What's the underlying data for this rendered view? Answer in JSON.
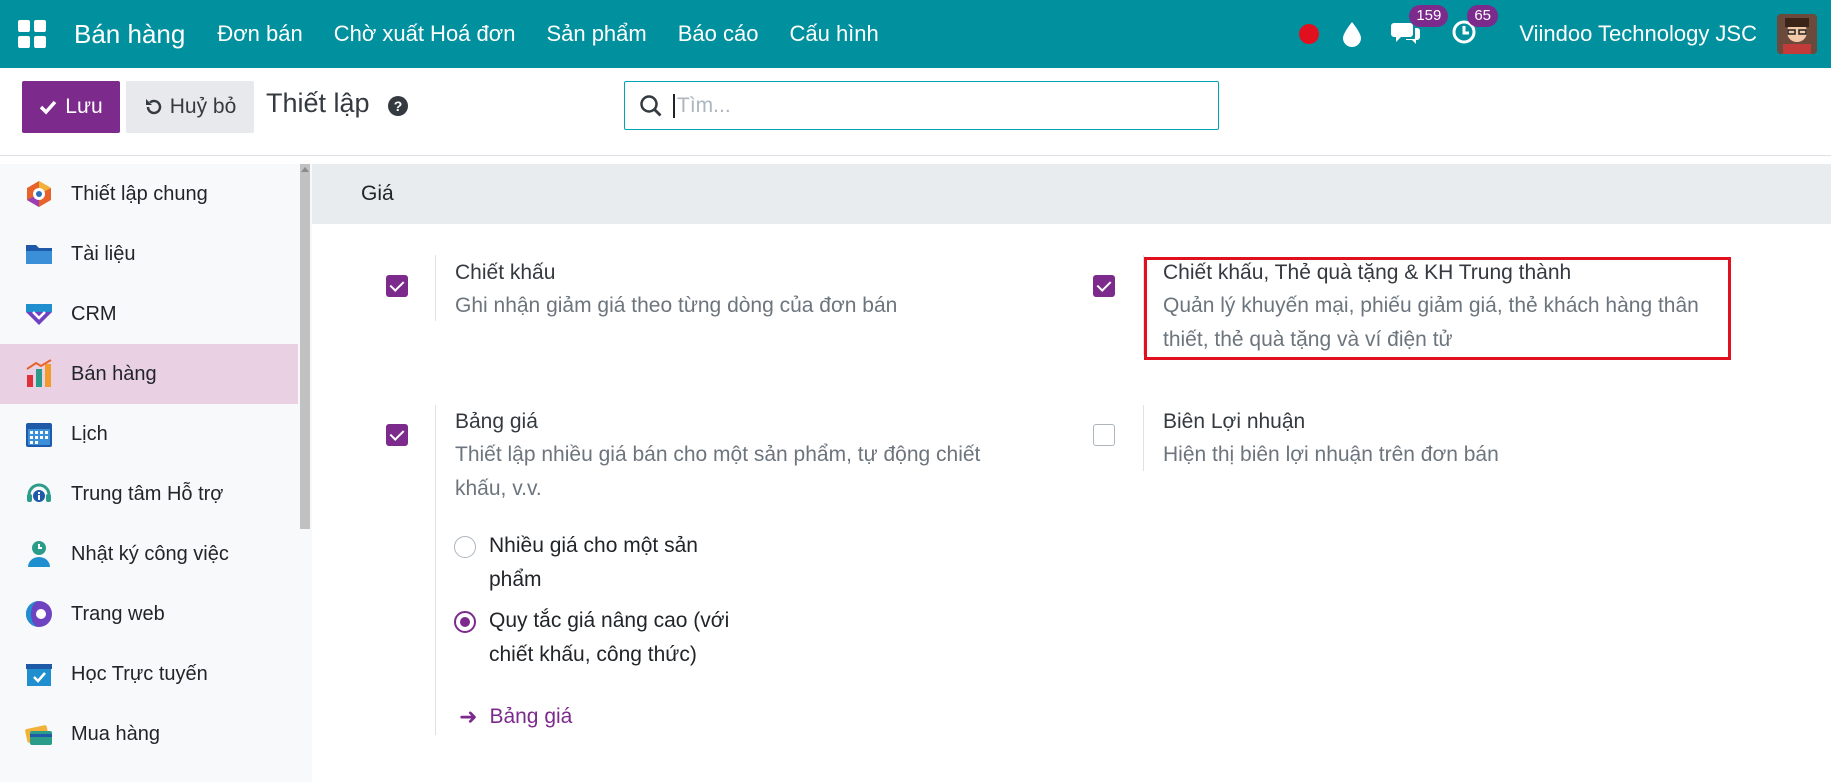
{
  "navbar": {
    "brand": "Bán hàng",
    "menu": [
      "Đơn bán",
      "Chờ xuất Hoá đơn",
      "Sản phẩm",
      "Báo cáo",
      "Cấu hình"
    ],
    "messages_badge": "159",
    "activities_badge": "65",
    "company": "Viindoo Technology JSC"
  },
  "control": {
    "save_label": "Lưu",
    "discard_label": "Huỷ bỏ",
    "title": "Thiết lập",
    "search_placeholder": "Tìm..."
  },
  "sidebar": {
    "items": [
      {
        "label": "Thiết lập chung",
        "icon": "settings-app-icon",
        "color": "#e8632a"
      },
      {
        "label": "Tài liệu",
        "icon": "folder-icon",
        "color": "#2c6fb8"
      },
      {
        "label": "CRM",
        "icon": "crm-icon",
        "color": "#2079d4"
      },
      {
        "label": "Bán hàng",
        "icon": "sales-chart-icon",
        "color": "#f29b2a",
        "active": true
      },
      {
        "label": "Lịch",
        "icon": "calendar-icon",
        "color": "#2c6fb8"
      },
      {
        "label": "Trung tâm Hỗ trợ",
        "icon": "helpdesk-icon",
        "color": "#17a2b8"
      },
      {
        "label": "Nhật ký công việc",
        "icon": "timesheet-icon",
        "color": "#17a2b8"
      },
      {
        "label": "Trang web",
        "icon": "website-icon",
        "color": "#6f42c1"
      },
      {
        "label": "Học Trực tuyến",
        "icon": "elearning-icon",
        "color": "#1f8fd0"
      },
      {
        "label": "Mua hàng",
        "icon": "purchase-icon",
        "color": "#2c9c8a"
      }
    ]
  },
  "section": {
    "title": "Giá",
    "settings": [
      {
        "title": "Chiết khấu",
        "desc": "Ghi nhận giảm giá theo từng dòng của đơn bán",
        "checked": true
      },
      {
        "title": "Chiết khấu, Thẻ quà tặng & KH Trung thành",
        "desc_line1": "Quản lý khuyến mại, phiếu giảm giá, thẻ khách hàng thân",
        "desc_line2": "thiết, thẻ quà tặng và ví điện tử",
        "checked": true
      },
      {
        "title": "Bảng giá",
        "desc_line1": "Thiết lập nhiều giá bán cho một sản phẩm, tự động chiết",
        "desc_line2": "khấu, v.v.",
        "checked": true
      },
      {
        "title": "Biên Lợi nhuận",
        "desc": "Hiện thị biên lợi nhuận trên đơn bán",
        "checked": false
      }
    ],
    "pricelist_options": [
      {
        "line1": "Nhiều giá cho một sản",
        "line2": "phẩm",
        "selected": false
      },
      {
        "line1": "Quy tắc giá nâng cao (với",
        "line2": "chiết khấu, công thức)",
        "selected": true
      }
    ],
    "pricelist_link": "Bảng giá"
  }
}
